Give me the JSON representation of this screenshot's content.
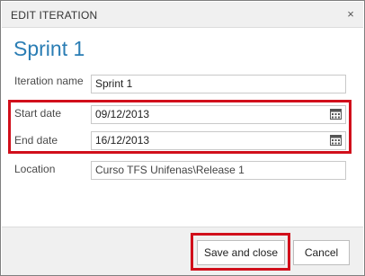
{
  "dialog": {
    "title": "EDIT ITERATION",
    "close_glyph": "×",
    "heading": "Sprint 1"
  },
  "fields": {
    "iteration_name": {
      "label": "Iteration name",
      "value": "Sprint 1"
    },
    "start_date": {
      "label": "Start date",
      "value": "09/12/2013",
      "icon": "calendar-icon"
    },
    "end_date": {
      "label": "End date",
      "value": "16/12/2013",
      "icon": "calendar-icon"
    },
    "location": {
      "label": "Location",
      "value": "Curso TFS Unifenas\\Release 1"
    }
  },
  "buttons": {
    "save": "Save and close",
    "cancel": "Cancel"
  },
  "colors": {
    "heading": "#2a7db4",
    "highlight": "#d10f1b",
    "titlebar": "#f0f0f0"
  }
}
